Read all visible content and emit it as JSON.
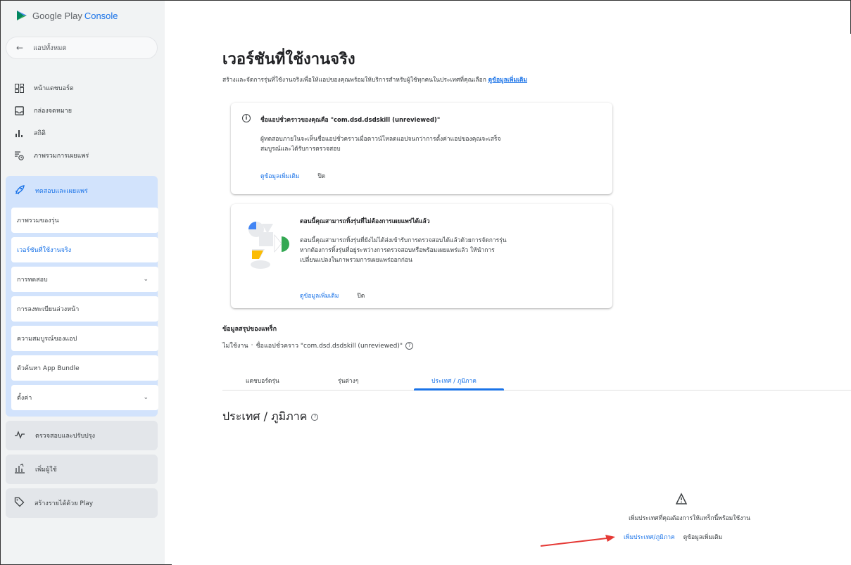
{
  "brand": {
    "name": "Google Play",
    "product": "Console"
  },
  "sidebar": {
    "back_label": "แอปทั้งหมด",
    "items": [
      {
        "label": "หน้าแดชบอร์ด",
        "icon": "dashboard-icon"
      },
      {
        "label": "กล่องจดหมาย",
        "icon": "inbox-icon"
      },
      {
        "label": "สถิติ",
        "icon": "bar-chart-icon"
      },
      {
        "label": "ภาพรวมการเผยแพร่",
        "icon": "publishing-overview-icon"
      }
    ],
    "test_release": {
      "label": "ทดสอบและเผยแพร่",
      "icon": "rocket-icon",
      "subitems": [
        {
          "label": "ภาพรวมของรุ่น"
        },
        {
          "label": "เวอร์ชันที่ใช้งานจริง",
          "active": true
        },
        {
          "label": "การทดสอบ",
          "expandable": true
        },
        {
          "label": "การลงทะเบียนล่วงหน้า"
        },
        {
          "label": "ความสมบูรณ์ของแอป"
        },
        {
          "label": "ตัวค้นหา App Bundle"
        },
        {
          "label": "ตั้งค่า",
          "expandable": true
        }
      ]
    },
    "groups": [
      {
        "label": "ตรวจสอบและปรับปรุง",
        "icon": "monitor-icon"
      },
      {
        "label": "เพิ่มผู้ใช้",
        "icon": "grow-users-icon"
      },
      {
        "label": "สร้างรายได้ด้วย Play",
        "icon": "tag-icon"
      }
    ]
  },
  "page": {
    "title": "เวอร์ชันที่ใช้งานจริง",
    "subtitle": "สร้างและจัดการรุ่นที่ใช้งานจริงเพื่อให้แอปของคุณพร้อมให้บริการสำหรับผู้ใช้ทุกคนในประเทศที่คุณเลือก",
    "subtitle_link": "ดูข้อมูลเพิ่มเติม"
  },
  "card1": {
    "heading": "ชื่อแอปชั่วคราวของคุณคือ \"com.dsd.dsdskill (unreviewed)\"",
    "body_line1": "ผู้ทดสอบภายในจะเห็นชื่อแอปชั่วคราวเมื่อดาวน์โหลดแอปจนกว่าการตั้งค่าแอปของคุณจะเสร็จ",
    "body_line2": "สมบูรณ์และได้รับการตรวจสอบ",
    "learn_more": "ดูข้อมูลเพิ่มเติม",
    "close": "ปิด"
  },
  "card2": {
    "heading": "ตอนนี้คุณสามารถทิ้งรุ่นที่ไม่ต้องการเผยแพร่ได้แล้ว",
    "body_line1": "ตอนนี้คุณสามารถทิ้งรุ่นที่ยังไม่ได้ส่งเข้ารับการตรวจสอบได้แล้วด้วยการจัดการรุ่น",
    "body_line2": "หากต้องการทิ้งรุ่นที่อยู่ระหว่างการตรวจสอบหรือพร้อมเผยแพร่แล้ว ให้นำการ",
    "body_line3": "เปลี่ยนแปลงในภาพรวมการเผยแพร่ออกก่อน",
    "learn_more": "ดูข้อมูลเพิ่มเติม",
    "close": "ปิด"
  },
  "track_summary": {
    "heading": "ข้อมูลสรุปของแทร็ก",
    "status": "ไม่ใช้งาน",
    "separator": "·",
    "app_name_text": "ชื่อแอปชั่วคราว \"com.dsd.dsdskill (unreviewed)\""
  },
  "tabs": [
    {
      "label": "แดชบอร์ดรุ่น"
    },
    {
      "label": "รุ่นต่างๆ"
    },
    {
      "label": "ประเทศ / ภูมิภาค",
      "active": true
    }
  ],
  "countries": {
    "title": "ประเทศ / ภูมิภาค",
    "empty_message": "เพิ่มประเทศที่คุณต้องการให้แทร็กนี้พร้อมใช้งาน",
    "add_button": "เพิ่มประเทศ/ภูมิภาค",
    "learn_more": "ดูข้อมูลเพิ่มเติม"
  },
  "colors": {
    "accent": "#1a73e8",
    "sidebar_bg": "#f1f3f4",
    "section_bg": "#d2e3fc",
    "annotation_arrow": "#e53935"
  }
}
